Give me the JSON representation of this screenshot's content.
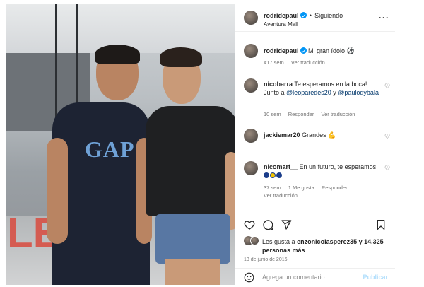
{
  "header": {
    "username": "rodridepaul",
    "separator": "•",
    "follow_status": "Siguiendo",
    "location": "Aventura Mall",
    "more_icon": "more-horizontal-icon"
  },
  "caption": {
    "username": "rodridepaul",
    "text": "Mi gran ídolo ⚽",
    "meta": "417 sem",
    "translate": "Ver traducción"
  },
  "comments": [
    {
      "username": "nicobarra",
      "text_prefix": "Te esperamos en la boca! Junto a",
      "mention1": "@leoparedes20",
      "conj": "y",
      "mention2": "@paulodybala",
      "time": "10 sem",
      "reply": "Responder",
      "translate": "Ver traducción"
    },
    {
      "username": "jackiemar20",
      "text": "Grandes 💪"
    },
    {
      "username": "nicomart__",
      "text": "En un futuro, te esperamos",
      "time": "37 sem",
      "likes": "1 Me gusta",
      "reply": "Responder",
      "translate": "Ver traducción"
    }
  ],
  "likes": {
    "prefix": "Les gusta a",
    "user": "enzonicolasperez35",
    "suffix": "y 14.325 personas más"
  },
  "date": "13 de junio de 2016",
  "add_comment": {
    "placeholder": "Agrega un comentario...",
    "publish": "Publicar"
  },
  "photo": {
    "sign_text": "LE",
    "shirt_logo": "GAP"
  },
  "colors": {
    "verified": "#0095f6",
    "link": "#00376b",
    "publish": "#b2dffc"
  }
}
